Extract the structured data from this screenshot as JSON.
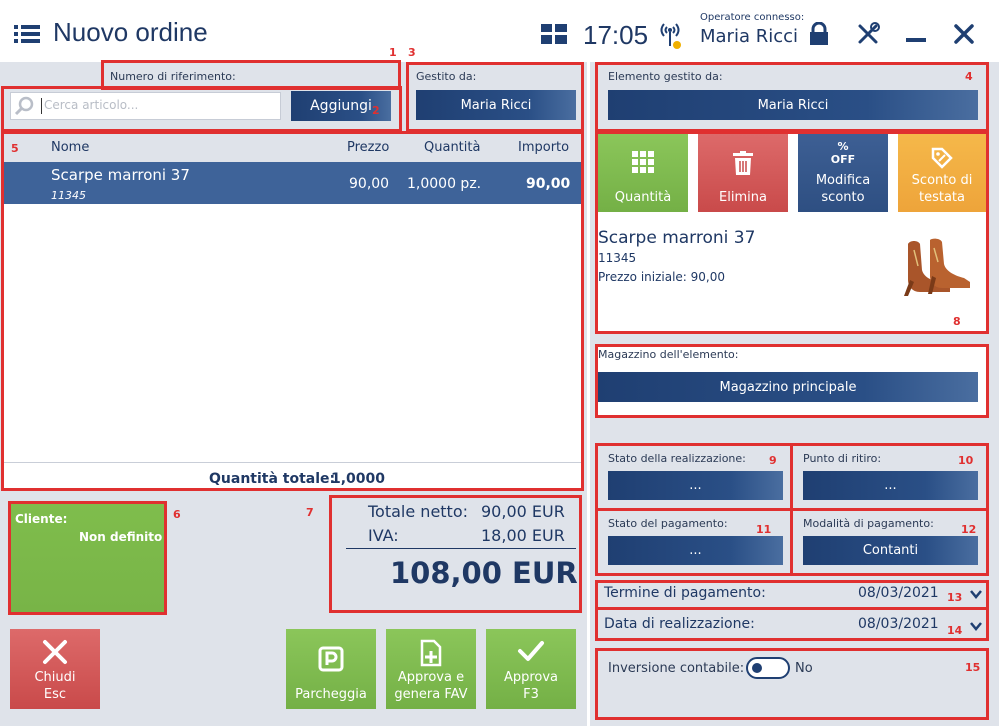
{
  "header": {
    "title": "Nuovo ordine",
    "time": "17:05",
    "operator_label": "Operatore connesso:",
    "operator_name": "Maria Ricci"
  },
  "left": {
    "ref_label": "Numero di riferimento:",
    "search_placeholder": "Cerca articolo...",
    "add_button": "Aggiungi",
    "managed_label": "Gestito da:",
    "managed_value": "Maria Ricci",
    "table": {
      "headers": {
        "name": "Nome",
        "price": "Prezzo",
        "qty": "Quantità",
        "amount": "Importo"
      },
      "rows": [
        {
          "name": "Scarpe marroni 37",
          "code": "11345",
          "price": "90,00",
          "qty": "1,0000 pz.",
          "amount": "90,00"
        }
      ]
    },
    "total_qty_label": "Quantità totale:",
    "total_qty_value": "1,0000"
  },
  "customer": {
    "label": "Cliente:",
    "value": "Non definito"
  },
  "totals": {
    "net_label": "Totale netto:",
    "net_value": "90,00 EUR",
    "vat_label": "IVA:",
    "vat_value": "18,00 EUR",
    "grand_total": "108,00 EUR"
  },
  "bottom_buttons": {
    "close": "Chiudi",
    "close_key": "Esc",
    "park": "Parcheggia",
    "approve_fav_1": "Approva e",
    "approve_fav_2": "genera FAV",
    "approve": "Approva",
    "approve_key": "F3"
  },
  "right": {
    "item_managed_label": "Elemento gestito da:",
    "item_managed_value": "Maria Ricci",
    "tiles": {
      "qty": "Quantità",
      "delete": "Elimina",
      "discount_1": "Modifica",
      "discount_2": "sconto",
      "discount_icon": "% OFF",
      "header_discount_1": "Sconto di",
      "header_discount_2": "testata"
    },
    "item": {
      "name": "Scarpe marroni 37",
      "code": "11345",
      "initial_price": "Prezzo iniziale: 90,00"
    },
    "warehouse_label": "Magazzino dell'elemento:",
    "warehouse_value": "Magazzino principale",
    "fulfillment_status_label": "Stato della realizzazione:",
    "fulfillment_status_value": "...",
    "pickup_label": "Punto di ritiro:",
    "pickup_value": "...",
    "payment_status_label": "Stato del pagamento:",
    "payment_status_value": "...",
    "payment_method_label": "Modalità di pagamento:",
    "payment_method_value": "Contanti",
    "payment_term_label": "Termine di pagamento:",
    "payment_term_value": "08/03/2021",
    "realization_date_label": "Data di realizzazione:",
    "realization_date_value": "08/03/2021",
    "reverse_charge_label": "Inversione contabile:",
    "reverse_charge_value": "No"
  },
  "markers": [
    "1",
    "2",
    "3",
    "4",
    "5",
    "6",
    "7",
    "8",
    "9",
    "10",
    "11",
    "12",
    "13",
    "14",
    "15"
  ],
  "colors": {
    "navy": "#1f3f72",
    "green": "#7ab648",
    "red": "#d9534f",
    "orange": "#f0a830",
    "annotation": "#e03030"
  }
}
